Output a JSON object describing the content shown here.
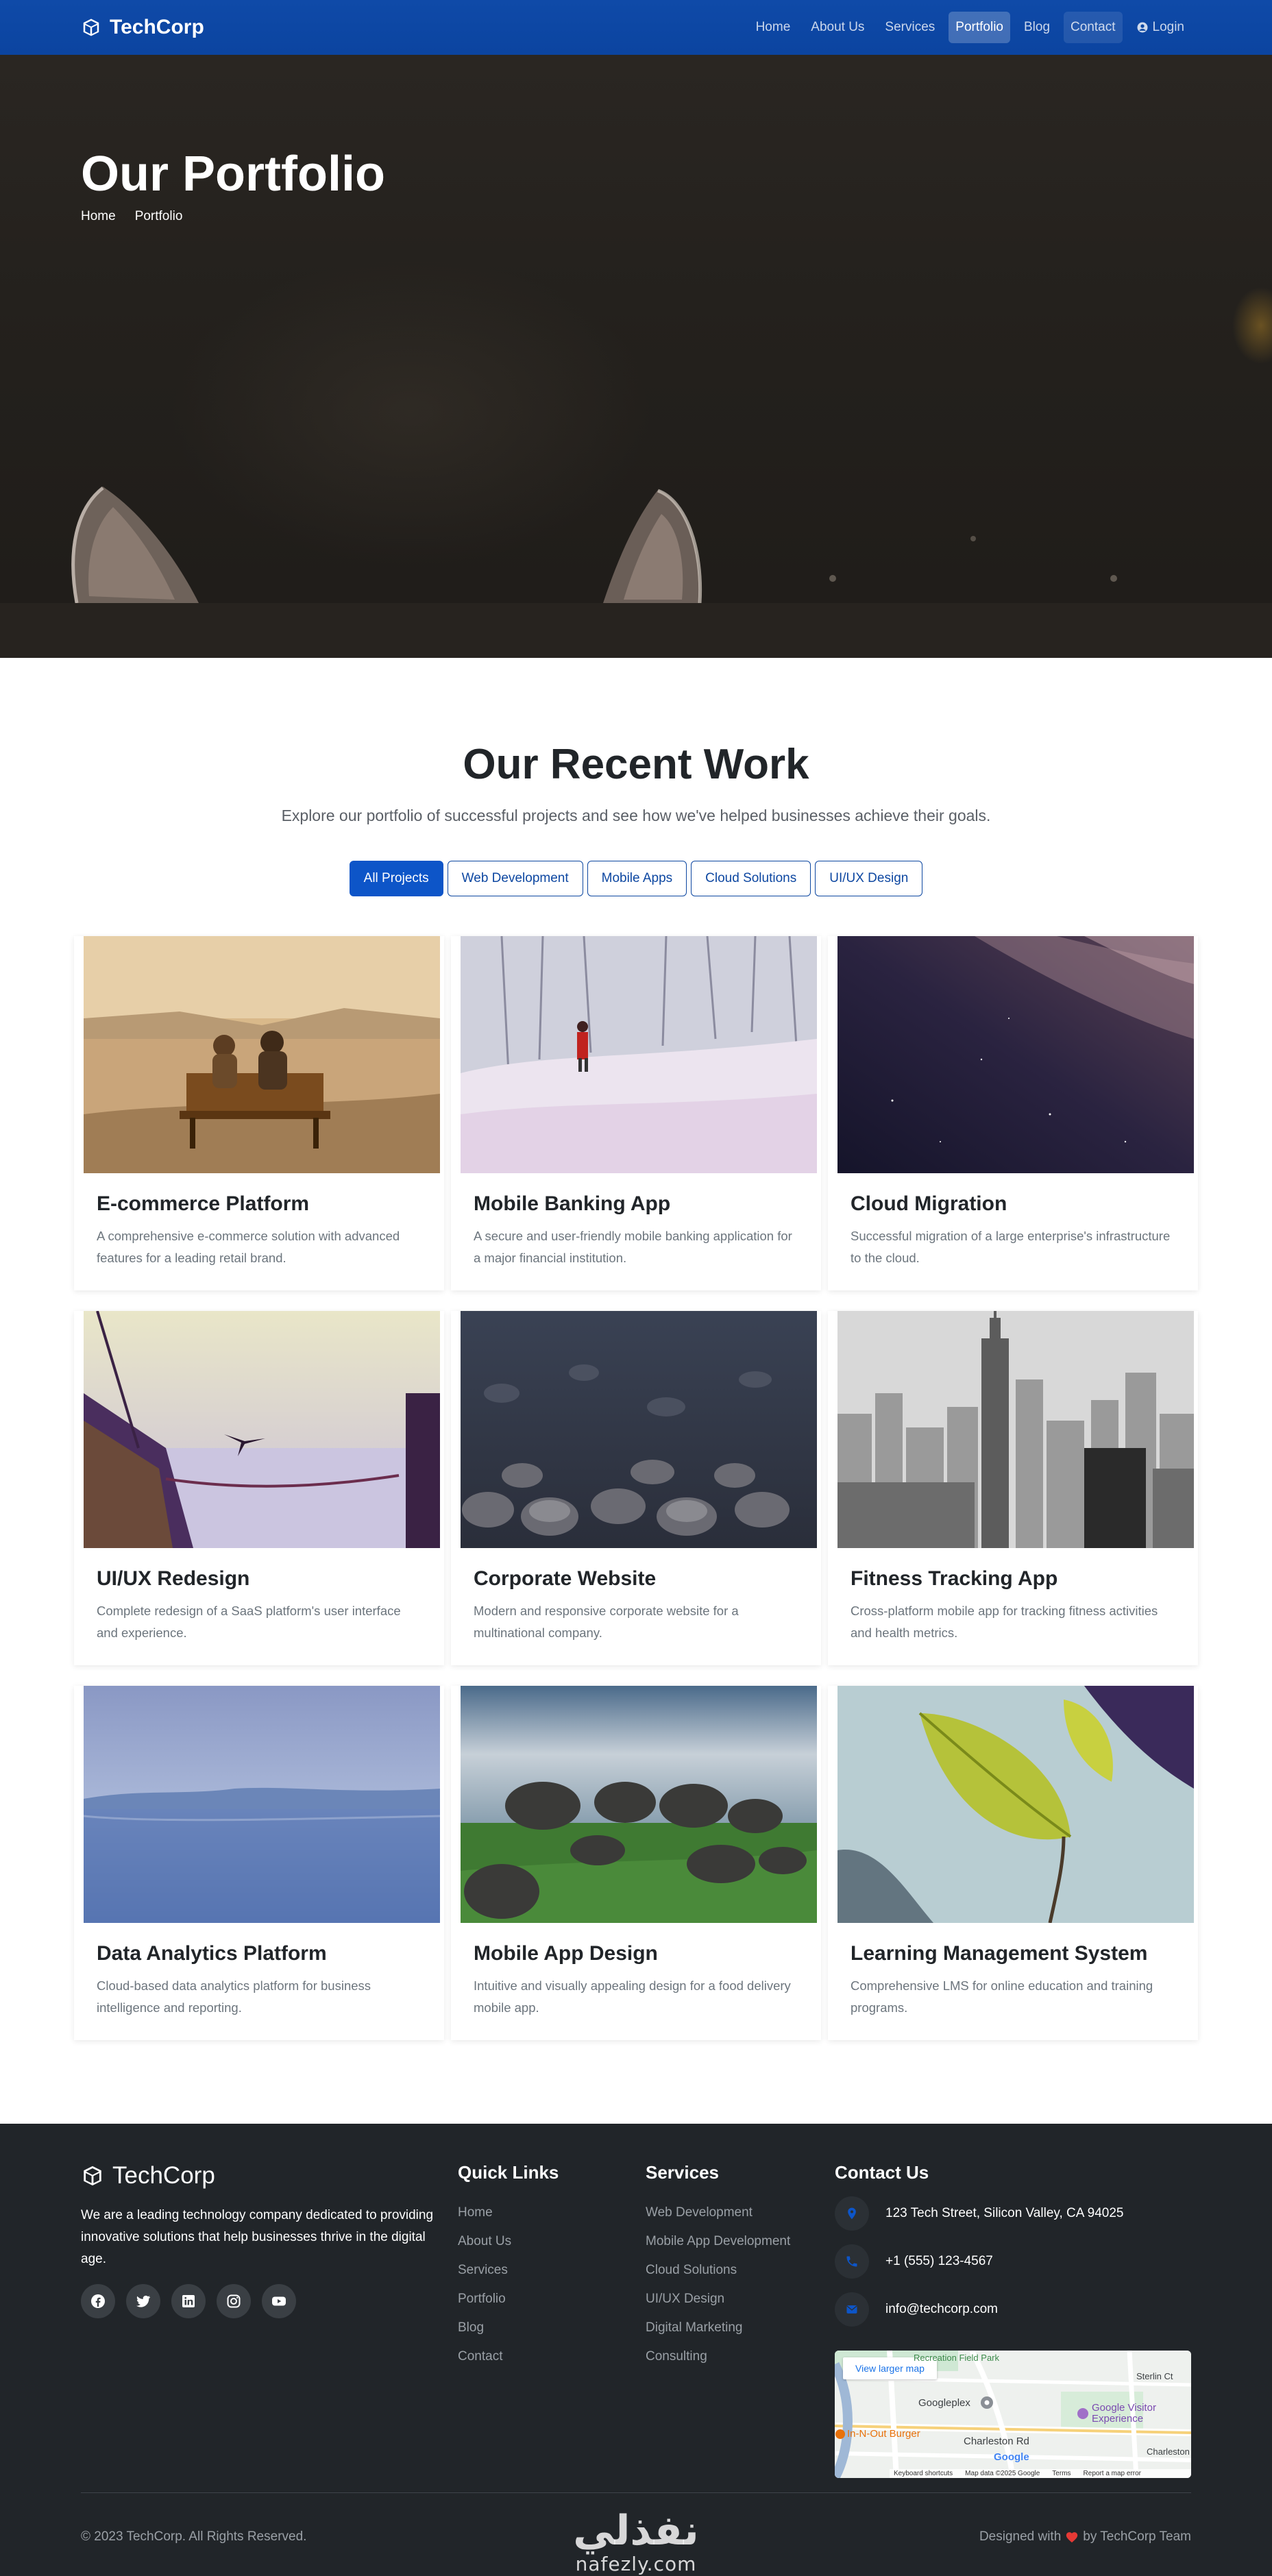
{
  "nav": {
    "brand": "TechCorp",
    "links": [
      {
        "label": "Home"
      },
      {
        "label": "About Us"
      },
      {
        "label": "Services"
      },
      {
        "label": "Portfolio"
      },
      {
        "label": "Blog"
      },
      {
        "label": "Contact"
      }
    ],
    "login": "Login",
    "active": "Portfolio"
  },
  "hero": {
    "title": "Our Portfolio",
    "breadcrumb": [
      "Home",
      "Portfolio"
    ]
  },
  "work": {
    "title": "Our Recent Work",
    "subtitle": "Explore our portfolio of successful projects and see how we've helped businesses achieve their goals.",
    "filters": [
      "All Projects",
      "Web Development",
      "Mobile Apps",
      "Cloud Solutions",
      "UI/UX Design"
    ],
    "active_filter": "All Projects",
    "projects": [
      {
        "title": "E-commerce Platform",
        "desc": "A comprehensive e-commerce solution with advanced features for a leading retail brand.",
        "image": "couple-on-bench"
      },
      {
        "title": "Mobile Banking App",
        "desc": "A secure and user-friendly mobile banking application for a major financial institution.",
        "image": "snow-forest"
      },
      {
        "title": "Cloud Migration",
        "desc": "Successful migration of a large enterprise's infrastructure to the cloud.",
        "image": "night-sky"
      },
      {
        "title": "UI/UX Redesign",
        "desc": "Complete redesign of a SaaS platform's user interface and experience.",
        "image": "boat-and-bird"
      },
      {
        "title": "Corporate Website",
        "desc": "Modern and responsive corporate website for a multinational company.",
        "image": "pebbles"
      },
      {
        "title": "Fitness Tracking App",
        "desc": "Cross-platform mobile app for tracking fitness activities and health metrics.",
        "image": "city-skyline"
      },
      {
        "title": "Data Analytics Platform",
        "desc": "Cloud-based data analytics platform for business intelligence and reporting.",
        "image": "misty-lake"
      },
      {
        "title": "Mobile App Design",
        "desc": "Intuitive and visually appealing design for a food delivery mobile app.",
        "image": "boulders-field"
      },
      {
        "title": "Learning Management System",
        "desc": "Comprehensive LMS for online education and training programs.",
        "image": "green-leaf"
      }
    ]
  },
  "footer": {
    "brand": "TechCorp",
    "about": "We are a leading technology company dedicated to providing innovative solutions that help businesses thrive in the digital age.",
    "socials": [
      "facebook-icon",
      "twitter-icon",
      "linkedin-icon",
      "instagram-icon",
      "youtube-icon"
    ],
    "quick_links_title": "Quick Links",
    "quick_links": [
      "Home",
      "About Us",
      "Services",
      "Portfolio",
      "Blog",
      "Contact"
    ],
    "services_title": "Services",
    "services": [
      "Web Development",
      "Mobile App Development",
      "Cloud Solutions",
      "UI/UX Design",
      "Digital Marketing",
      "Consulting"
    ],
    "contact_title": "Contact Us",
    "contact": {
      "address": "123 Tech Street, Silicon Valley, CA 94025",
      "phone": "+1 (555) 123-4567",
      "email": "info@techcorp.com"
    },
    "map": {
      "link": "View larger map",
      "labels": [
        "Googleplex",
        "Google Visitor Experience",
        "In-N-Out Burger",
        "Charleston Rd",
        "Sterlin Ct",
        "Charleston",
        "Recreation Field Park",
        "Google"
      ],
      "footer_items": [
        "Keyboard shortcuts",
        "Map data ©2025 Google",
        "Terms",
        "Report a map error"
      ]
    },
    "copyright": "© 2023 TechCorp. All Rights Reserved.",
    "designed_prefix": "Designed with",
    "designed_suffix": "by TechCorp Team",
    "watermark_ar": "نفذلي",
    "watermark_lat": "nafezly.com"
  },
  "colors": {
    "primary": "#0d47a1",
    "primary_button": "#0d55c8",
    "footer_bg": "#212529",
    "heart": "#e53935"
  }
}
